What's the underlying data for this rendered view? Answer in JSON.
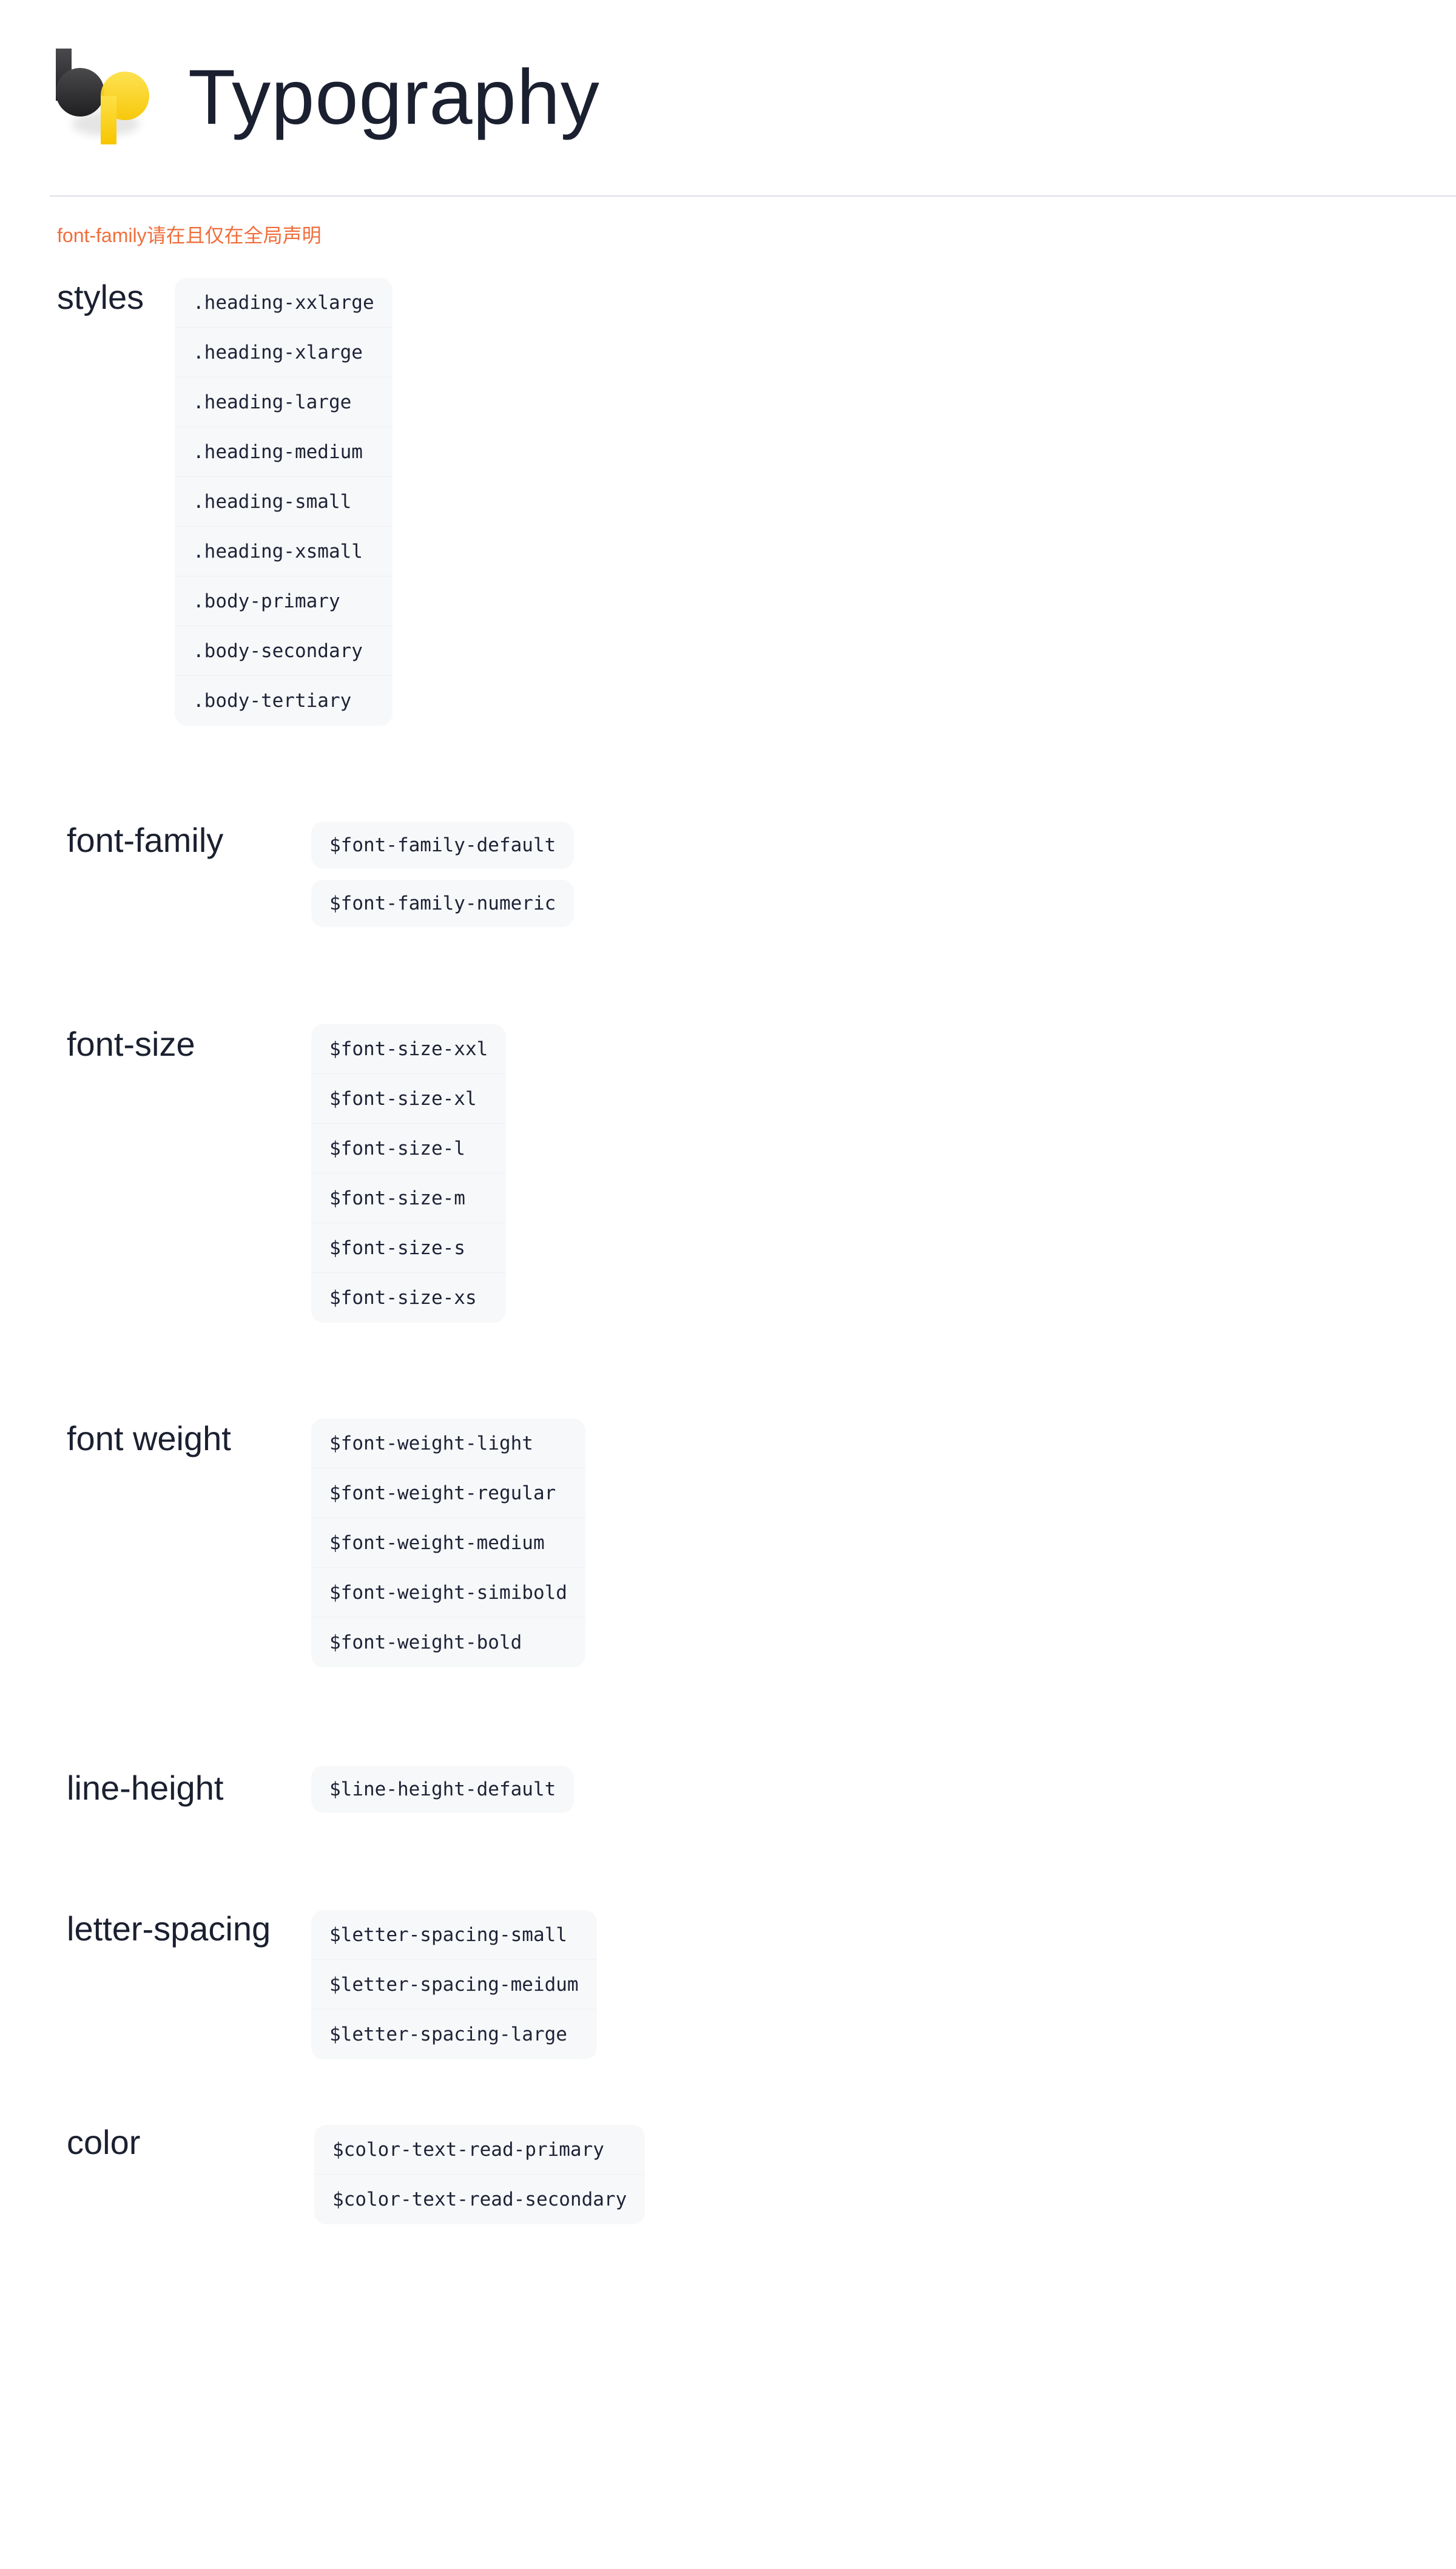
{
  "header": {
    "title": "Typography",
    "logo_colors": {
      "dark": "#2b2b2e",
      "yellow": "#f9d51c"
    }
  },
  "note": "font-family请在且仅在全局声明",
  "sections": {
    "styles": {
      "label": "styles",
      "tokens": [
        ".heading-xxlarge",
        ".heading-xlarge",
        ".heading-large",
        ".heading-medium",
        ".heading-small",
        ".heading-xsmall",
        ".body-primary",
        ".body-secondary",
        ".body-tertiary"
      ]
    },
    "font_family": {
      "label": "font-family",
      "tokens": [
        "$font-family-default",
        "$font-family-numeric"
      ]
    },
    "font_size": {
      "label": "font-size",
      "tokens": [
        "$font-size-xxl",
        "$font-size-xl",
        "$font-size-l",
        "$font-size-m",
        "$font-size-s",
        "$font-size-xs"
      ]
    },
    "font_weight": {
      "label": "font weight",
      "tokens": [
        "$font-weight-light",
        "$font-weight-regular",
        "$font-weight-medium",
        "$font-weight-simibold",
        "$font-weight-bold"
      ]
    },
    "line_height": {
      "label": "line-height",
      "tokens": [
        "$line-height-default"
      ]
    },
    "letter_spacing": {
      "label": "letter-spacing",
      "tokens": [
        "$letter-spacing-small",
        "$letter-spacing-meidum",
        "$letter-spacing-large"
      ]
    },
    "color": {
      "label": "color",
      "tokens": [
        "$color-text-read-primary",
        "$color-text-read-secondary"
      ]
    }
  }
}
